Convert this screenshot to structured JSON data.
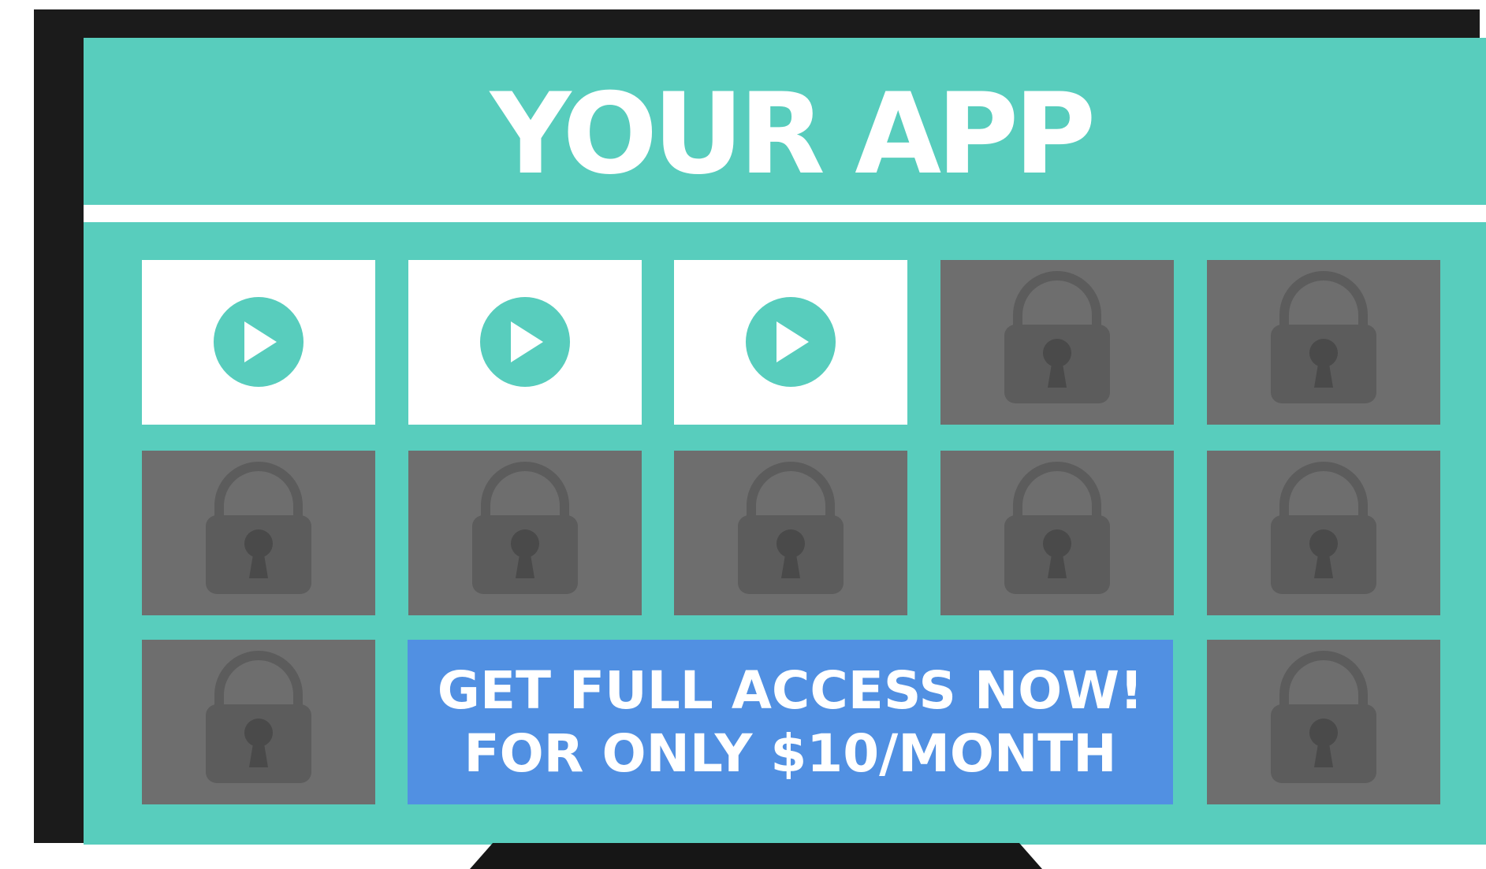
{
  "app": {
    "title": "YOUR APP"
  },
  "tiles": [
    {
      "state": "unlocked",
      "icon": "play-icon"
    },
    {
      "state": "unlocked",
      "icon": "play-icon"
    },
    {
      "state": "unlocked",
      "icon": "play-icon"
    },
    {
      "state": "locked",
      "icon": "lock-icon"
    },
    {
      "state": "locked",
      "icon": "lock-icon"
    },
    {
      "state": "locked",
      "icon": "lock-icon"
    },
    {
      "state": "locked",
      "icon": "lock-icon"
    },
    {
      "state": "locked",
      "icon": "lock-icon"
    },
    {
      "state": "locked",
      "icon": "lock-icon"
    },
    {
      "state": "locked",
      "icon": "lock-icon"
    },
    {
      "state": "locked",
      "icon": "lock-icon"
    },
    {
      "state": "locked",
      "icon": "lock-icon"
    }
  ],
  "cta": {
    "line1": "GET FULL ACCESS NOW!",
    "line2": "FOR ONLY $10/MONTH"
  },
  "colors": {
    "screen_bg": "#58cdbd",
    "accent": "#58cdbd",
    "locked_tile": "#6e6e6e",
    "lock_icon": "#5c5c5c",
    "cta_bg": "#5190e2",
    "frame": "#1b1b1b"
  }
}
